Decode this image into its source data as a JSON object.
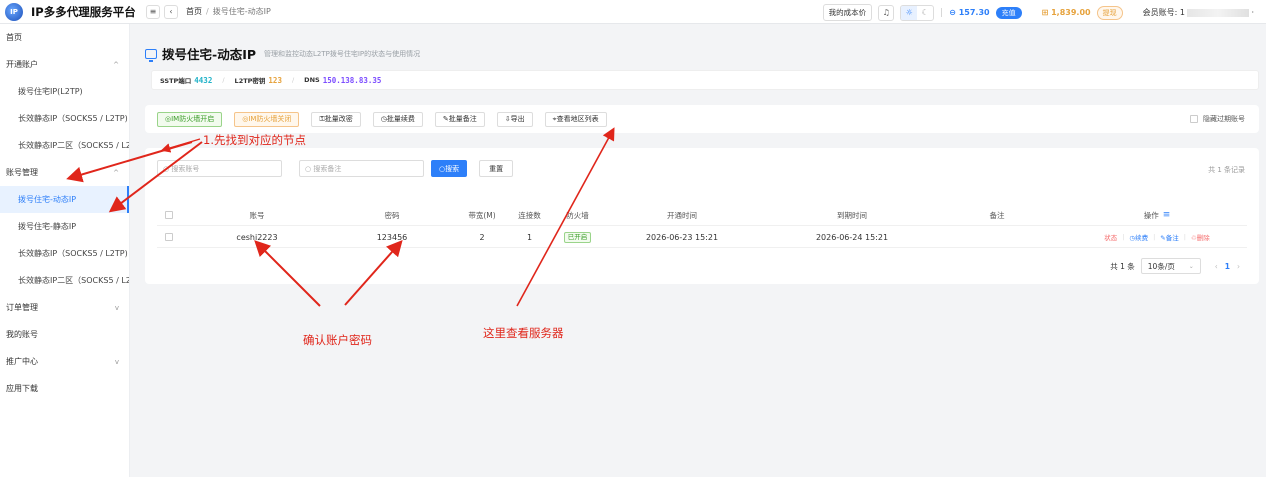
{
  "header": {
    "brand": "IP多多代理服务平台",
    "logo_text": "IP",
    "breadcrumb": {
      "home": "首页",
      "current": "拨号住宅-动态IP"
    },
    "cost_price": "我的成本价",
    "balance": "157.30",
    "recharge": "充值",
    "points": "1,839.00",
    "withdraw": "提现",
    "account_label": "会员账号: 1"
  },
  "sidebar": {
    "items": [
      {
        "label": "首页",
        "level": 1
      },
      {
        "label": "开通账户",
        "level": 1,
        "chevron": "^"
      },
      {
        "label": "拨号住宅IP(L2TP)",
        "level": 2
      },
      {
        "label": "长效静态IP（SOCKS5 / L2TP)",
        "level": 2
      },
      {
        "label": "长效静态IP二区（SOCKS5 / L2TP)",
        "level": 2
      },
      {
        "label": "账号管理",
        "level": 1,
        "chevron": "^"
      },
      {
        "label": "拨号住宅-动态IP",
        "level": 2,
        "active": true
      },
      {
        "label": "拨号住宅-静态IP",
        "level": 2
      },
      {
        "label": "长效静态IP（SOCKS5 / L2TP)",
        "level": 2
      },
      {
        "label": "长效静态IP二区（SOCKS5 / L2TP)",
        "level": 2
      },
      {
        "label": "订单管理",
        "level": 1,
        "chevron": "v"
      },
      {
        "label": "我的账号",
        "level": 1
      },
      {
        "label": "推广中心",
        "level": 1,
        "chevron": "v"
      },
      {
        "label": "应用下载",
        "level": 1
      }
    ]
  },
  "page": {
    "title": "拨号住宅-动态IP",
    "description": "管理和监控动态L2TP拨号住宅IP的状态与使用情况",
    "info": {
      "sstp_label": "SSTP端口",
      "sstp_value": "4432",
      "l2tp_label": "L2TP密钥",
      "l2tp_value": "123",
      "dns_label": "DNS",
      "dns_value": "150.138.83.35"
    }
  },
  "toolbar": {
    "buttons": [
      {
        "label": "◎IM防火墙开启",
        "style": "green"
      },
      {
        "label": "◎IM防火墙关闭",
        "style": "orange"
      },
      {
        "label": "⚿批量改密",
        "style": "default"
      },
      {
        "label": "◷批量续费",
        "style": "default"
      },
      {
        "label": "✎批量备注",
        "style": "default"
      },
      {
        "label": "⇩导出",
        "style": "default"
      },
      {
        "label": "⌖查看地区列表",
        "style": "default"
      }
    ],
    "hide_expired": "隐藏过期账号"
  },
  "search": {
    "account_placeholder": "搜索账号",
    "note_placeholder": "搜索备注",
    "search_button": "搜索",
    "reset_button": "重置",
    "total_top": "共 1 条记录"
  },
  "table": {
    "columns": [
      "账号",
      "密码",
      "带宽(M)",
      "连接数",
      "防火墙",
      "开通时间",
      "到期时间",
      "备注",
      "操作"
    ],
    "rows": [
      {
        "account": "ceshi2223",
        "password": "123456",
        "bandwidth": "2",
        "connections": "1",
        "firewall": "已开启",
        "open_time": "2026-06-23 15:21",
        "expire_time": "2026-06-24 15:21",
        "note": "",
        "ops": {
          "status": "状态",
          "renew": "◷续费",
          "note": "✎备注",
          "delete": "♲删除"
        }
      }
    ]
  },
  "pager": {
    "total": "共 1 条",
    "page_size": "10条/页",
    "current_page": "1"
  },
  "annotations": {
    "step1": "1.先找到对应的节点",
    "confirm": "确认账户密码",
    "server": "这里查看服务器"
  },
  "colors": {
    "primary": "#2d7ff9",
    "annotation": "#e0261b",
    "success": "#3c9d2a",
    "warning": "#e6a23c"
  }
}
